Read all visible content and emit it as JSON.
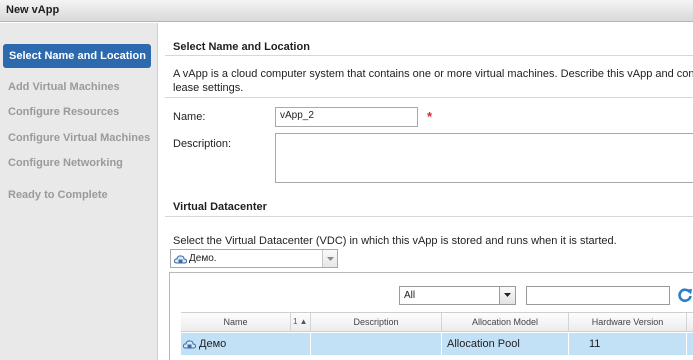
{
  "window": {
    "title": "New vApp"
  },
  "sidebar": {
    "steps": [
      {
        "label": "Select Name and Location",
        "active": true
      },
      {
        "label": "Add Virtual Machines",
        "active": false
      },
      {
        "label": "Configure Resources",
        "active": false
      },
      {
        "label": "Configure Virtual Machines",
        "active": false
      },
      {
        "label": "Configure Networking",
        "active": false
      },
      {
        "label": "Ready to Complete",
        "active": false
      }
    ]
  },
  "section_name": {
    "heading": "Select Name and Location",
    "description_line1": "A vApp is a cloud computer system that contains one or more virtual machines. Describe this vApp and con",
    "description_line2": "lease settings.",
    "name_label": "Name:",
    "name_value": "vApp_2",
    "required_marker": "*",
    "description_label": "Description:",
    "description_value": ""
  },
  "section_vdc": {
    "heading": "Virtual Datacenter",
    "instruction": "Select the Virtual Datacenter (VDC) in which this vApp is stored and runs when it is started.",
    "vdc_selected": "Демо.",
    "filter_selected": "All",
    "search_value": "",
    "table": {
      "columns": [
        "Name",
        "1",
        "Description",
        "Allocation Model",
        "Hardware Version"
      ],
      "sort_indicator": "1 ▲",
      "rows": [
        {
          "name": "Демо",
          "description": "",
          "allocation_model": "Allocation Pool",
          "hardware_version": "11"
        }
      ]
    }
  },
  "colors": {
    "accent": "#2c69ad",
    "selected_row": "#c2e1f7",
    "required": "#d9262b",
    "refresh": "#2a7ec9"
  },
  "icons": [
    "cloud-datacenter-icon",
    "chevron-down-icon",
    "refresh-icon",
    "sort-ascending-icon"
  ]
}
